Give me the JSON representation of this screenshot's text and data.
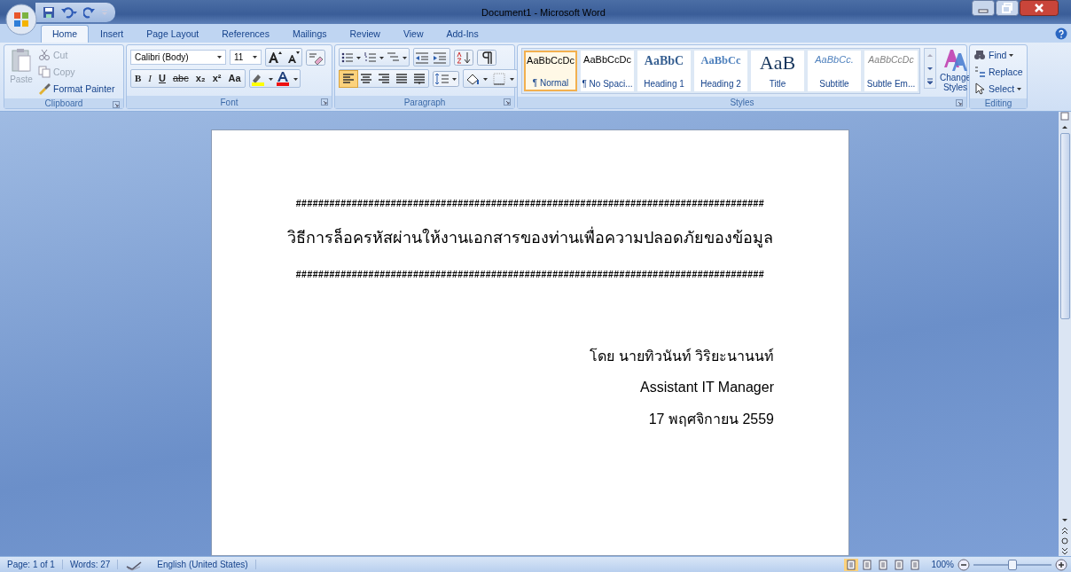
{
  "window": {
    "title": "Document1 - Microsoft Word"
  },
  "tabs": [
    {
      "label": "Home",
      "selected": true
    },
    {
      "label": "Insert",
      "selected": false
    },
    {
      "label": "Page Layout",
      "selected": false
    },
    {
      "label": "References",
      "selected": false
    },
    {
      "label": "Mailings",
      "selected": false
    },
    {
      "label": "Review",
      "selected": false
    },
    {
      "label": "View",
      "selected": false
    },
    {
      "label": "Add-Ins",
      "selected": false
    }
  ],
  "clipboard": {
    "label": "Clipboard",
    "paste": {
      "label": "Paste",
      "disabled": true
    },
    "buttons": [
      {
        "kind": "cut",
        "label": "Cut",
        "disabled": true
      },
      {
        "kind": "copy",
        "label": "Copy",
        "disabled": true
      },
      {
        "kind": "painter",
        "label": "Format Painter",
        "disabled": false
      }
    ]
  },
  "font": {
    "label": "Font",
    "font_name": "Calibri (Body)",
    "font_size": "11",
    "format_buttons": [
      {
        "kind": "bold",
        "text": "B"
      },
      {
        "kind": "italic",
        "text": "I"
      },
      {
        "kind": "underline",
        "text": "U"
      },
      {
        "kind": "strike",
        "text": "abc"
      },
      {
        "kind": "sub",
        "text": "x₂"
      },
      {
        "kind": "sup",
        "text": "x²"
      },
      {
        "kind": "case",
        "text": "Aa"
      }
    ]
  },
  "paragraph": {
    "label": "Paragraph",
    "align_buttons": [
      {
        "kind": "left",
        "selected": true
      },
      {
        "kind": "center",
        "selected": false
      },
      {
        "kind": "right",
        "selected": false
      },
      {
        "kind": "justify",
        "selected": false
      },
      {
        "kind": "distributed",
        "selected": false
      }
    ]
  },
  "styles": {
    "label": "Styles",
    "items": [
      {
        "kind": "normal",
        "sample": "AaBbCcDc",
        "label": "¶ Normal",
        "selected": true
      },
      {
        "kind": "normal",
        "sample": "AaBbCcDc",
        "label": "¶ No Spaci...",
        "selected": false
      },
      {
        "kind": "h1",
        "sample": "AaBbC",
        "label": "Heading 1",
        "selected": false
      },
      {
        "kind": "h2",
        "sample": "AaBbCc",
        "label": "Heading 2",
        "selected": false
      },
      {
        "kind": "title",
        "sample": "AaB",
        "label": "Title",
        "selected": false
      },
      {
        "kind": "subtitle",
        "sample": "AaBbCc.",
        "label": "Subtitle",
        "selected": false
      },
      {
        "kind": "subtle",
        "sample": "AaBbCcDc",
        "label": "Subtle Em...",
        "selected": false
      }
    ],
    "change_styles": "Change Styles"
  },
  "editing": {
    "label": "Editing",
    "buttons": [
      {
        "kind": "find",
        "label": "Find"
      },
      {
        "kind": "replace",
        "label": "Replace"
      },
      {
        "kind": "select",
        "label": "Select"
      }
    ]
  },
  "document": {
    "lines": [
      {
        "kind": "rule",
        "text": "####################################################################################"
      },
      {
        "kind": "heading",
        "text": "วิธีการล็อครหัสผ่านให้งานเอกสารของท่านเพื่อความปลอดภัยของข้อมูล"
      },
      {
        "kind": "rule",
        "text": "####################################################################################"
      },
      {
        "kind": "right",
        "text": "โดย นายทิวนันท์ วิริยะนานนท์"
      },
      {
        "kind": "right",
        "text": "Assistant IT Manager"
      },
      {
        "kind": "right",
        "text": "17 พฤศจิกายน 2559"
      }
    ]
  },
  "status_bar": {
    "page": "Page: 1 of 1",
    "words": "Words: 27",
    "language": "English (United States)",
    "views": [
      {
        "selected": true
      },
      {
        "selected": false
      },
      {
        "selected": false
      },
      {
        "selected": false
      },
      {
        "selected": false
      }
    ],
    "zoom": "100%",
    "zoom_level": {
      "level": 0.5
    }
  }
}
